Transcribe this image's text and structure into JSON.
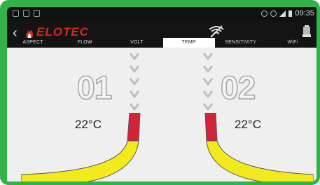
{
  "status_bar": {
    "time": "09:35"
  },
  "app_bar": {
    "logo_text": "ELOTEC",
    "back_icon": "back-chevron-icon",
    "center_icon": "wifi-slash-icon",
    "right_icon": "battery-icon"
  },
  "tabs": [
    {
      "label": "ASPECT",
      "active": false
    },
    {
      "label": "FLOW",
      "active": false
    },
    {
      "label": "VOLT",
      "active": false
    },
    {
      "label": "TEMP",
      "active": true
    },
    {
      "label": "SENSITIVITY",
      "active": false
    },
    {
      "label": "WiFi",
      "active": false
    }
  ],
  "sensors": [
    {
      "number": "01",
      "temperature": "22°C"
    },
    {
      "number": "02",
      "temperature": "22°C"
    }
  ],
  "colors": {
    "frame": "#34b24a",
    "red_segment": "#d2233a",
    "yellow_segment": "#f3ea1d",
    "accent": "#d32b1f"
  }
}
